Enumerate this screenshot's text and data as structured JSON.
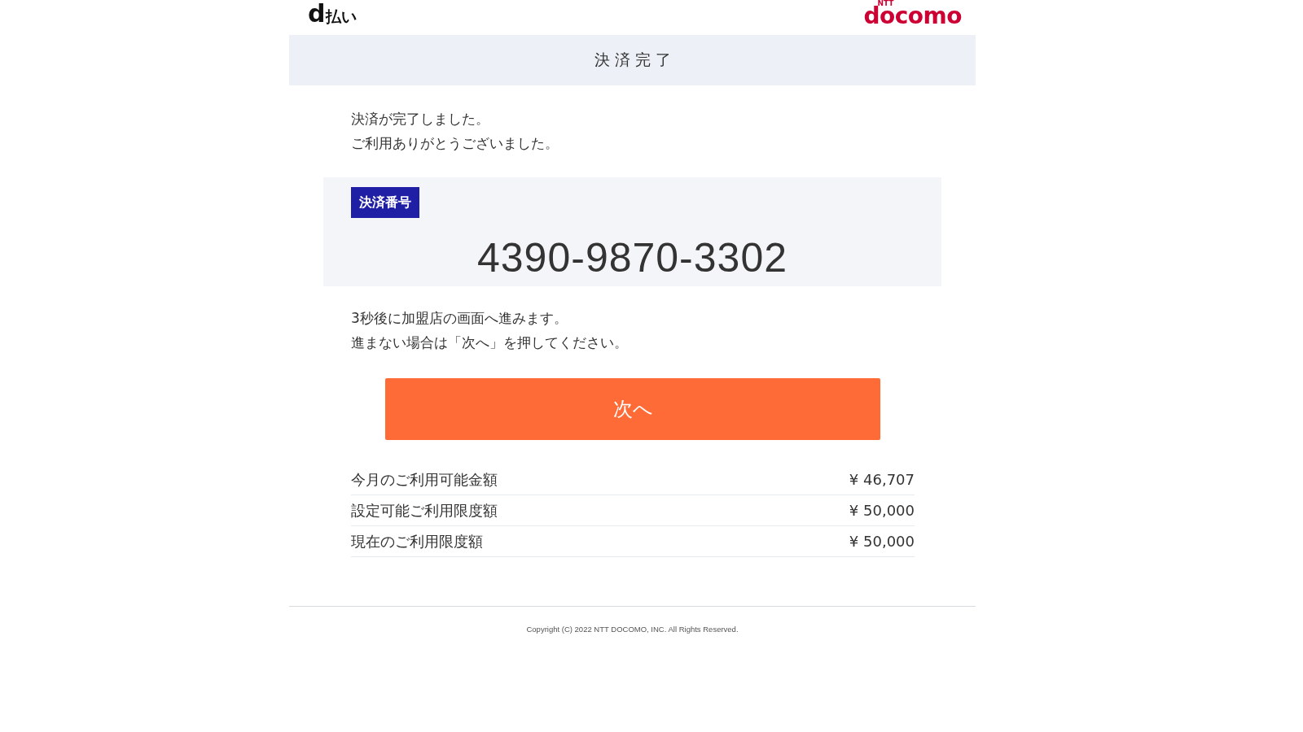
{
  "header": {
    "service_logo": {
      "mark": "d",
      "text": "払い"
    },
    "brand_logo": {
      "small": "NTT",
      "text": "docomo"
    }
  },
  "title": "決済完了",
  "message": [
    "決済が完了しました。",
    "ご利用ありがとうございました。"
  ],
  "payment_number": {
    "label": "決済番号",
    "value": "4390-9870-3302"
  },
  "notice": [
    "3秒後に加盟店の画面へ進みます。",
    "進まない場合は「次へ」を押してください。"
  ],
  "next_button": "次へ",
  "limits": [
    {
      "label": "今月のご利用可能金額",
      "amount": "¥ 46,707"
    },
    {
      "label": "設定可能ご利用限度額",
      "amount": "¥ 50,000"
    },
    {
      "label": "現在のご利用限度額",
      "amount": "¥ 50,000"
    }
  ],
  "footer": {
    "copyright": "Copyright (C) 2022 NTT DOCOMO, INC. All Rights Reserved."
  }
}
